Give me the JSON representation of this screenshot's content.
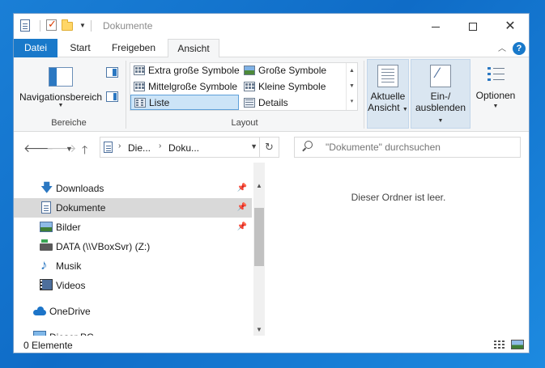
{
  "window": {
    "title": "Dokumente",
    "controls": {
      "minimize": "—",
      "maximize": "☐",
      "close": "✕"
    }
  },
  "ribbon": {
    "tabs": [
      "Datei",
      "Start",
      "Freigeben",
      "Ansicht"
    ],
    "active_tab": "Ansicht",
    "help": "?",
    "groups": {
      "bereiche": {
        "label": "Bereiche",
        "navigation_pane": "Navigationsbereich"
      },
      "layout": {
        "label": "Layout",
        "items": [
          {
            "label": "Extra große Symbole",
            "icon": "grid-icon"
          },
          {
            "label": "Große Symbole",
            "icon": "picture-icon"
          },
          {
            "label": "Mittelgroße Symbole",
            "icon": "grid-icon"
          },
          {
            "label": "Kleine Symbole",
            "icon": "grid-icon"
          },
          {
            "label": "Liste",
            "icon": "list-icon",
            "selected": true
          },
          {
            "label": "Details",
            "icon": "details-icon"
          }
        ]
      },
      "current_view": {
        "line1": "Aktuelle",
        "line2": "Ansicht"
      },
      "show_hide": {
        "line1": "Ein-/",
        "line2": "ausblenden"
      },
      "options": {
        "label": "Optionen"
      }
    }
  },
  "address": {
    "crumbs": [
      "Die...",
      "Doku..."
    ],
    "search_placeholder": "\"Dokumente\" durchsuchen"
  },
  "nav": {
    "items": [
      {
        "label": "Downloads",
        "icon": "download-icon",
        "pinned": true
      },
      {
        "label": "Dokumente",
        "icon": "document-icon",
        "pinned": true,
        "selected": true
      },
      {
        "label": "Bilder",
        "icon": "pictures-icon",
        "pinned": true
      },
      {
        "label": "DATA (\\\\VBoxSvr) (Z:)",
        "icon": "network-drive-icon"
      },
      {
        "label": "Musik",
        "icon": "music-icon"
      },
      {
        "label": "Videos",
        "icon": "videos-icon"
      },
      {
        "label": "OneDrive",
        "icon": "onedrive-icon"
      },
      {
        "label": "Dieser PC",
        "icon": "this-pc-icon"
      }
    ]
  },
  "content": {
    "empty_message": "Dieser Ordner ist leer."
  },
  "status": {
    "count": "0 Elemente"
  },
  "colors": {
    "accent": "#1979ca",
    "selection": "#cce4f7",
    "nav_selected": "#d9d9d9",
    "ribbon_bg": "#f5f6f7"
  }
}
